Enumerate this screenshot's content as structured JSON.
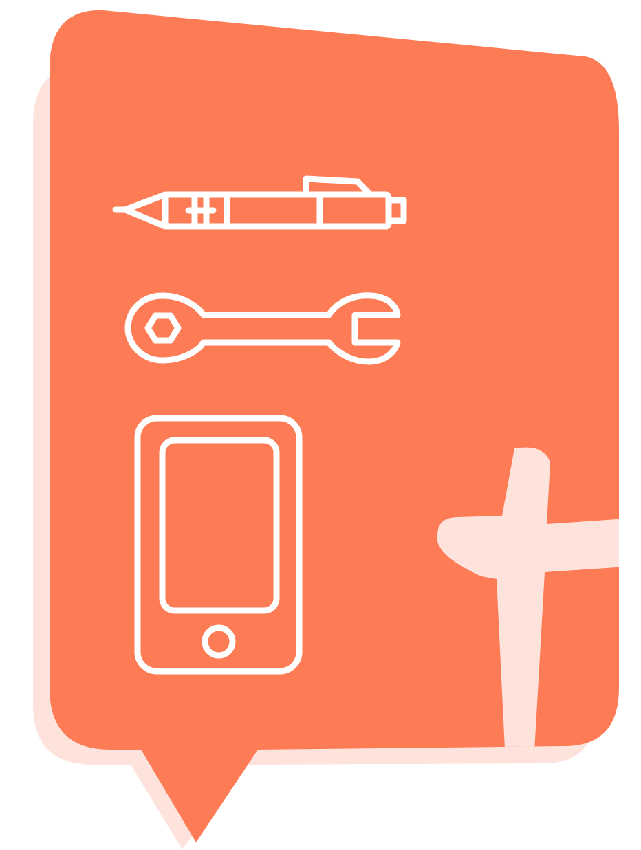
{
  "colors": {
    "background": "#ffffff",
    "bubble_fill": "#fd7b55",
    "bubble_shadow": "#fde3dc",
    "icon_stroke": "#ffffff",
    "figure_fill": "#fde3dc"
  },
  "icons": [
    "pen-icon",
    "wrench-icon",
    "smartphone-icon"
  ]
}
